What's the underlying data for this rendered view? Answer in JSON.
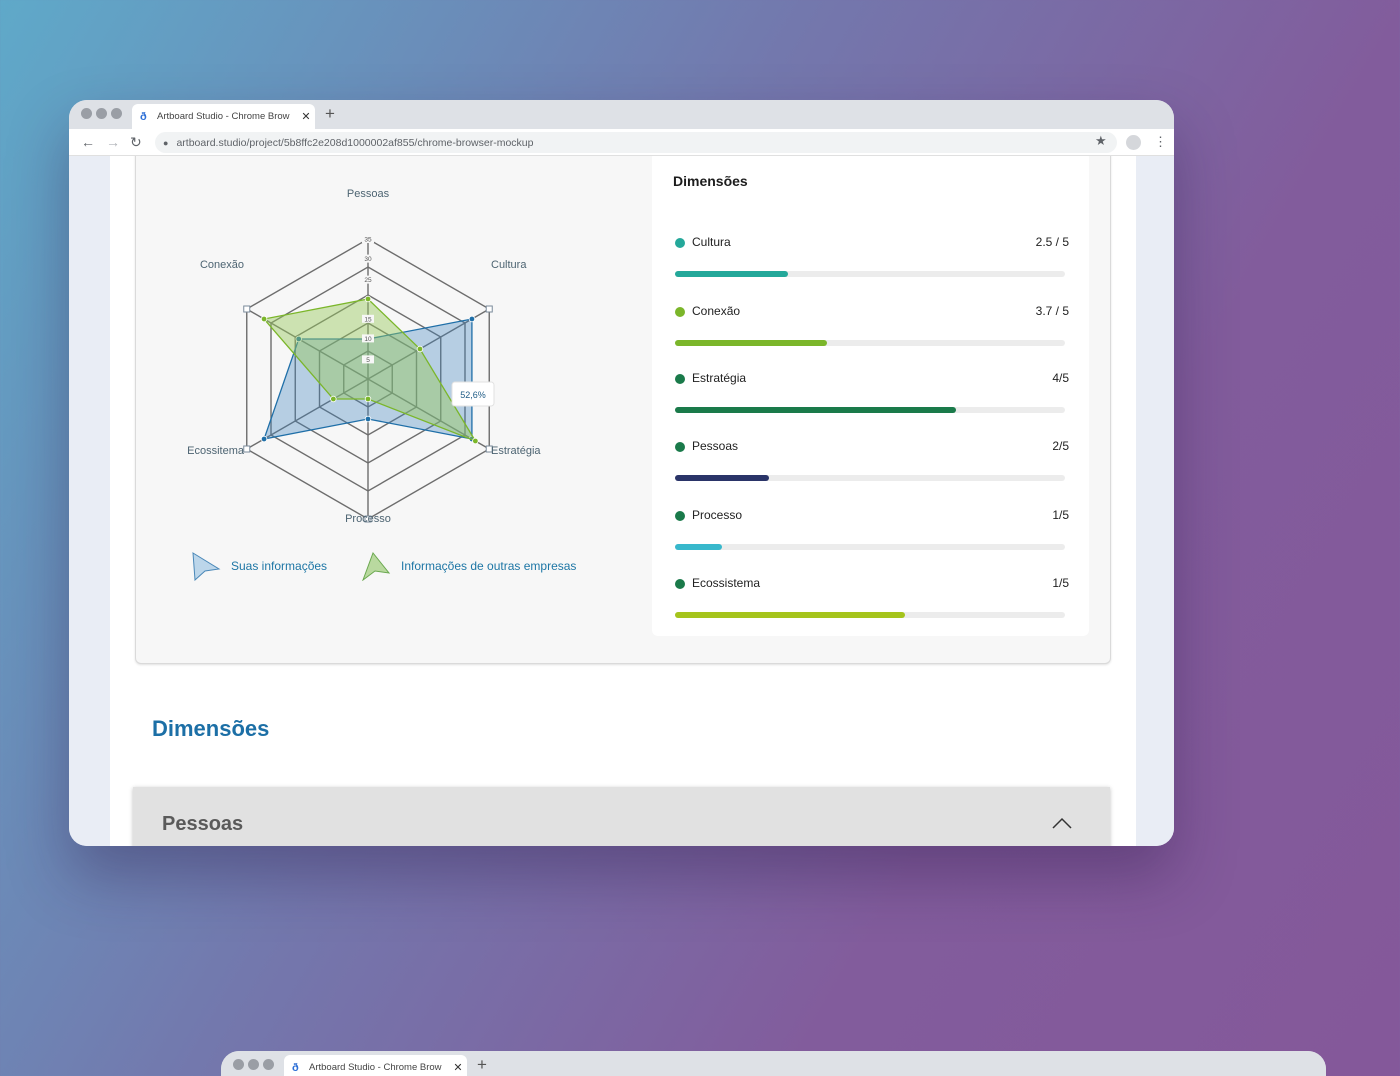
{
  "browser": {
    "tab_title": "Artboard Studio - Chrome Brow",
    "tab_close": "✕",
    "new_tab": "+",
    "favicon": "artboard-logo-icon",
    "url": "artboard.studio/project/5b8ffc2e208d1000002af855/chrome-browser-mockup",
    "nav": {
      "back": "←",
      "forward": "→",
      "reload": "↻",
      "lock": "🔒",
      "star": "★",
      "menu": "⋮"
    }
  },
  "browser2": {
    "tab_title": "Artboard Studio - Chrome Brow",
    "tab_close": "✕",
    "new_tab": "+"
  },
  "radar": {
    "axes": [
      "Pessoas",
      "Cultura",
      "Estratégia",
      "Processo",
      "Ecossitema",
      "Conexão"
    ],
    "ticks": [
      "35",
      "30",
      "25",
      "15",
      "10",
      "5"
    ],
    "tooltip": "52,6%"
  },
  "chart_data": {
    "type": "radar",
    "categories": [
      "Pessoas",
      "Cultura",
      "Estratégia",
      "Processo",
      "Ecossitema",
      "Conexão"
    ],
    "rmax": 35,
    "ticks": [
      5,
      10,
      15,
      20,
      25,
      30,
      35
    ],
    "series": [
      {
        "name": "Suas informações",
        "color": "#1f6fa8",
        "values": [
          10,
          30,
          30,
          10,
          30,
          20
        ]
      },
      {
        "name": "Informações de outras empresas",
        "color": "#7bb62a",
        "values": [
          20,
          15,
          31,
          5,
          10,
          30
        ]
      }
    ]
  },
  "legend": {
    "own": "Suas informações",
    "others": "Informações de outras empresas"
  },
  "dimensions_panel": {
    "title": "Dimensões",
    "items": [
      {
        "name": "Cultura",
        "score": "2.5 / 5",
        "progress": 0.29,
        "bullet": "#24a89a",
        "bar": "#24a89a"
      },
      {
        "name": "Conexão",
        "score": "3.7 / 5",
        "progress": 0.39,
        "bullet": "#7bb62a",
        "bar": "#7bb62a"
      },
      {
        "name": "Estratégia",
        "score": "4/5",
        "progress": 0.72,
        "bullet": "#1a7a4a",
        "bar": "#1a7a4a"
      },
      {
        "name": "Pessoas",
        "score": "2/5",
        "progress": 0.24,
        "bullet": "#1a7a4a",
        "bar": "#2a3468"
      },
      {
        "name": "Processo",
        "score": "1/5",
        "progress": 0.12,
        "bullet": "#1a7a4a",
        "bar": "#38b8cc"
      },
      {
        "name": "Ecossistema",
        "score": "1/5",
        "progress": 0.59,
        "bullet": "#1a7a4a",
        "bar": "#a5c41c"
      }
    ]
  },
  "section": {
    "title": "Dimensões"
  },
  "accordion": {
    "title": "Pessoas",
    "expanded": true
  }
}
